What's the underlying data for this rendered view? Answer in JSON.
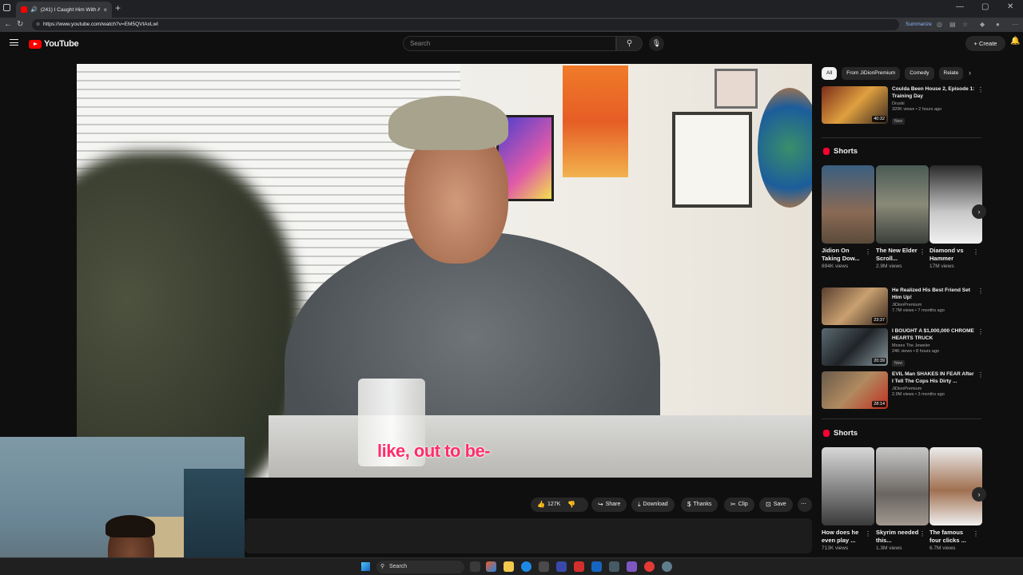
{
  "browser": {
    "tab_title": "(241) I Caught Him With A M",
    "url": "https://www.youtube.com/watch?v=EM5QVtAxLwI",
    "summarize_label": "Summarize"
  },
  "header": {
    "logo_text": "YouTube",
    "search_placeholder": "Search",
    "create_label": "Create"
  },
  "video": {
    "caption": "like, out to be-"
  },
  "actions": {
    "like_count": "127K",
    "share": "Share",
    "download": "Download",
    "thanks": "Thanks",
    "clip": "Clip",
    "save": "Save"
  },
  "chips": [
    "All",
    "From JiDionPremium",
    "Comedy",
    "Relate"
  ],
  "recs_top": [
    {
      "title": "Coulda Been House 2, Episode 1: Training Day",
      "channel": "Druski",
      "meta": "320K views • 2 hours ago",
      "badge": "New",
      "duration": "40:32"
    }
  ],
  "shorts1": {
    "heading": "Shorts",
    "items": [
      {
        "title": "Jidion On Taking Dow...",
        "views": "894K views"
      },
      {
        "title": "The New Elder Scroll...",
        "views": "2.9M views"
      },
      {
        "title": "Diamond vs Hammer",
        "views": "17M views"
      }
    ]
  },
  "recs_mid": [
    {
      "title": "He Realized His Best Friend Set Him Up!",
      "channel": "JiDionPremium",
      "meta": "7.7M views • 7 months ago",
      "badge": "",
      "duration": "23:37"
    },
    {
      "title": "I BOUGHT A $1,000,000 CHROME HEARTS TRUCK",
      "channel": "Moses The Jeweler",
      "meta": "24K views • 8 hours ago",
      "badge": "New",
      "duration": "20:39"
    },
    {
      "title": "EVIL Man SHAKES IN FEAR After I Tell The Cops His Dirty ...",
      "channel": "JiDionPremium",
      "meta": "2.9M views • 3 months ago",
      "badge": "",
      "duration": "28:14"
    }
  ],
  "shorts2": {
    "heading": "Shorts",
    "items": [
      {
        "title": "How does he even play ...",
        "views": "713K views"
      },
      {
        "title": "Skyrim needed this...",
        "views": "1.3M views"
      },
      {
        "title": "The famous four clicks ...",
        "views": "6.7M views"
      }
    ]
  },
  "taskbar": {
    "search_label": "Search"
  },
  "colors": {
    "background": "#0f0f0f",
    "brand_red": "#ff0000",
    "caption_pink": "#ff2d6b"
  }
}
